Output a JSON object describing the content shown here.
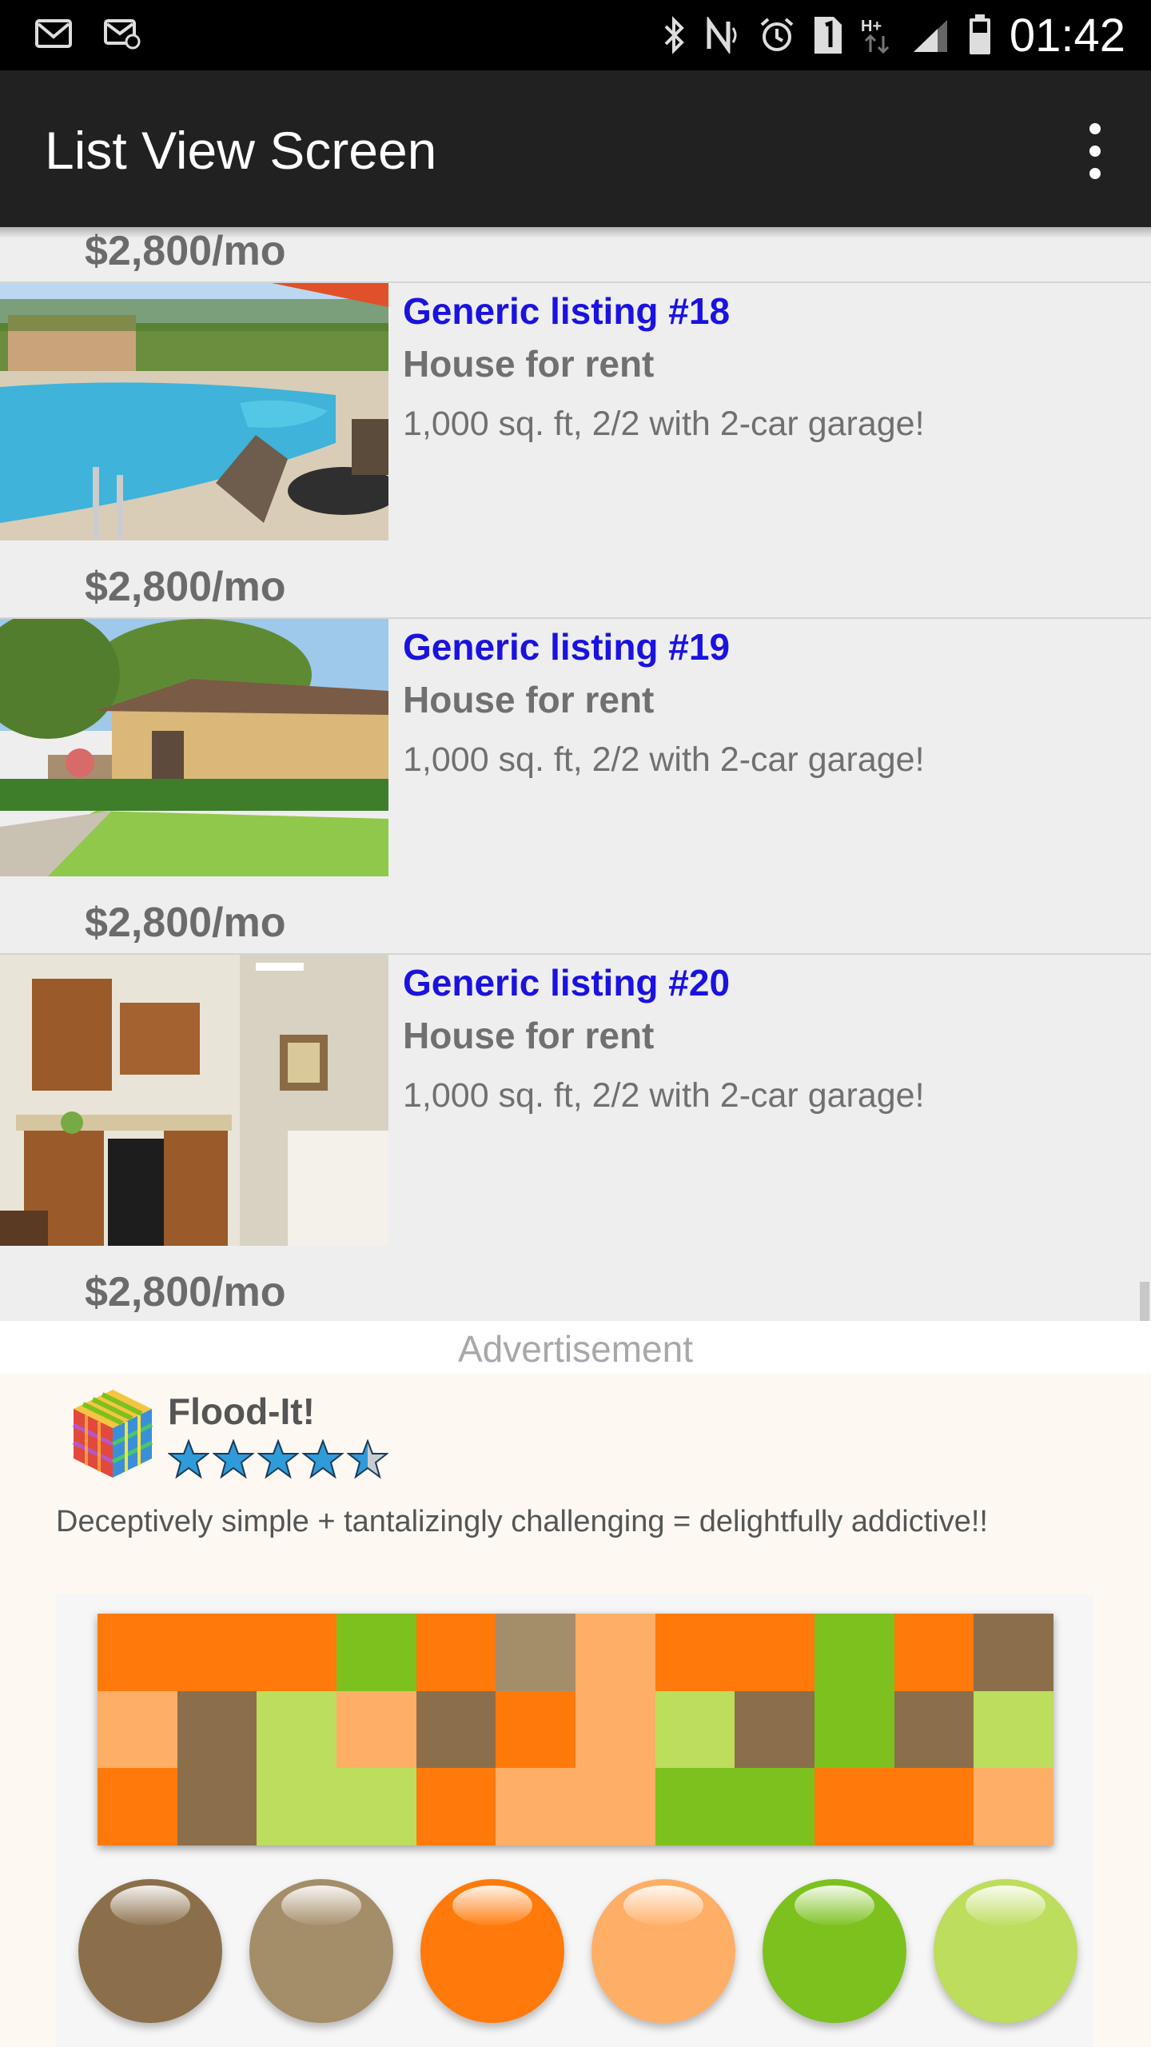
{
  "status_bar": {
    "time": "01:42",
    "left_icons": [
      "gmail-icon",
      "email-icon"
    ],
    "right_icons": [
      "bluetooth-icon",
      "nfc-icon",
      "alarm-icon",
      "sim-1-icon",
      "hplus-data-icon",
      "signal-icon",
      "battery-icon"
    ]
  },
  "app_bar": {
    "title": "List View Screen",
    "overflow_icon": "more-vert-icon"
  },
  "list": {
    "top_partial_price": "$2,800/mo",
    "items": [
      {
        "title": "Generic listing #18",
        "type": "House for rent",
        "description": "1,000 sq. ft, 2/2 with 2-car garage!",
        "price": "$2,800/mo",
        "image": "pool-photo"
      },
      {
        "title": "Generic listing #19",
        "type": "House for rent",
        "description": "1,000 sq. ft, 2/2 with 2-car garage!",
        "price": "$2,800/mo",
        "image": "house-exterior-photo"
      },
      {
        "title": "Generic listing #20",
        "type": "House for rent",
        "description": "1,000 sq. ft, 2/2 with 2-car garage!",
        "price": "$2,800/mo",
        "image": "kitchen-photo"
      }
    ]
  },
  "ad": {
    "label": "Advertisement",
    "app_name": "Flood-It!",
    "rating": 4.5,
    "description": "Deceptively simple + tantalizingly challenging = delightfully addictive!!",
    "board_colors": {
      "O": "#ff7a0a",
      "G": "#7cc11e",
      "T": "#a48d69",
      "P": "#ffae66",
      "L": "#bddd5c",
      "B": "#8b6f4b"
    },
    "board_rows": [
      [
        "O",
        "O",
        "O",
        "G",
        "O",
        "T",
        "P",
        "O",
        "O",
        "G",
        "O",
        "B"
      ],
      [
        "P",
        "B",
        "L",
        "P",
        "B",
        "O",
        "P",
        "L",
        "B",
        "G",
        "B",
        "L"
      ],
      [
        "O",
        "B",
        "L",
        "L",
        "O",
        "P",
        "P",
        "G",
        "G",
        "O",
        "O",
        "P"
      ]
    ],
    "ball_colors": [
      "#8b6f4b",
      "#a48d69",
      "#ff7a0a",
      "#ffae66",
      "#7cc11e",
      "#bddd5c"
    ]
  }
}
